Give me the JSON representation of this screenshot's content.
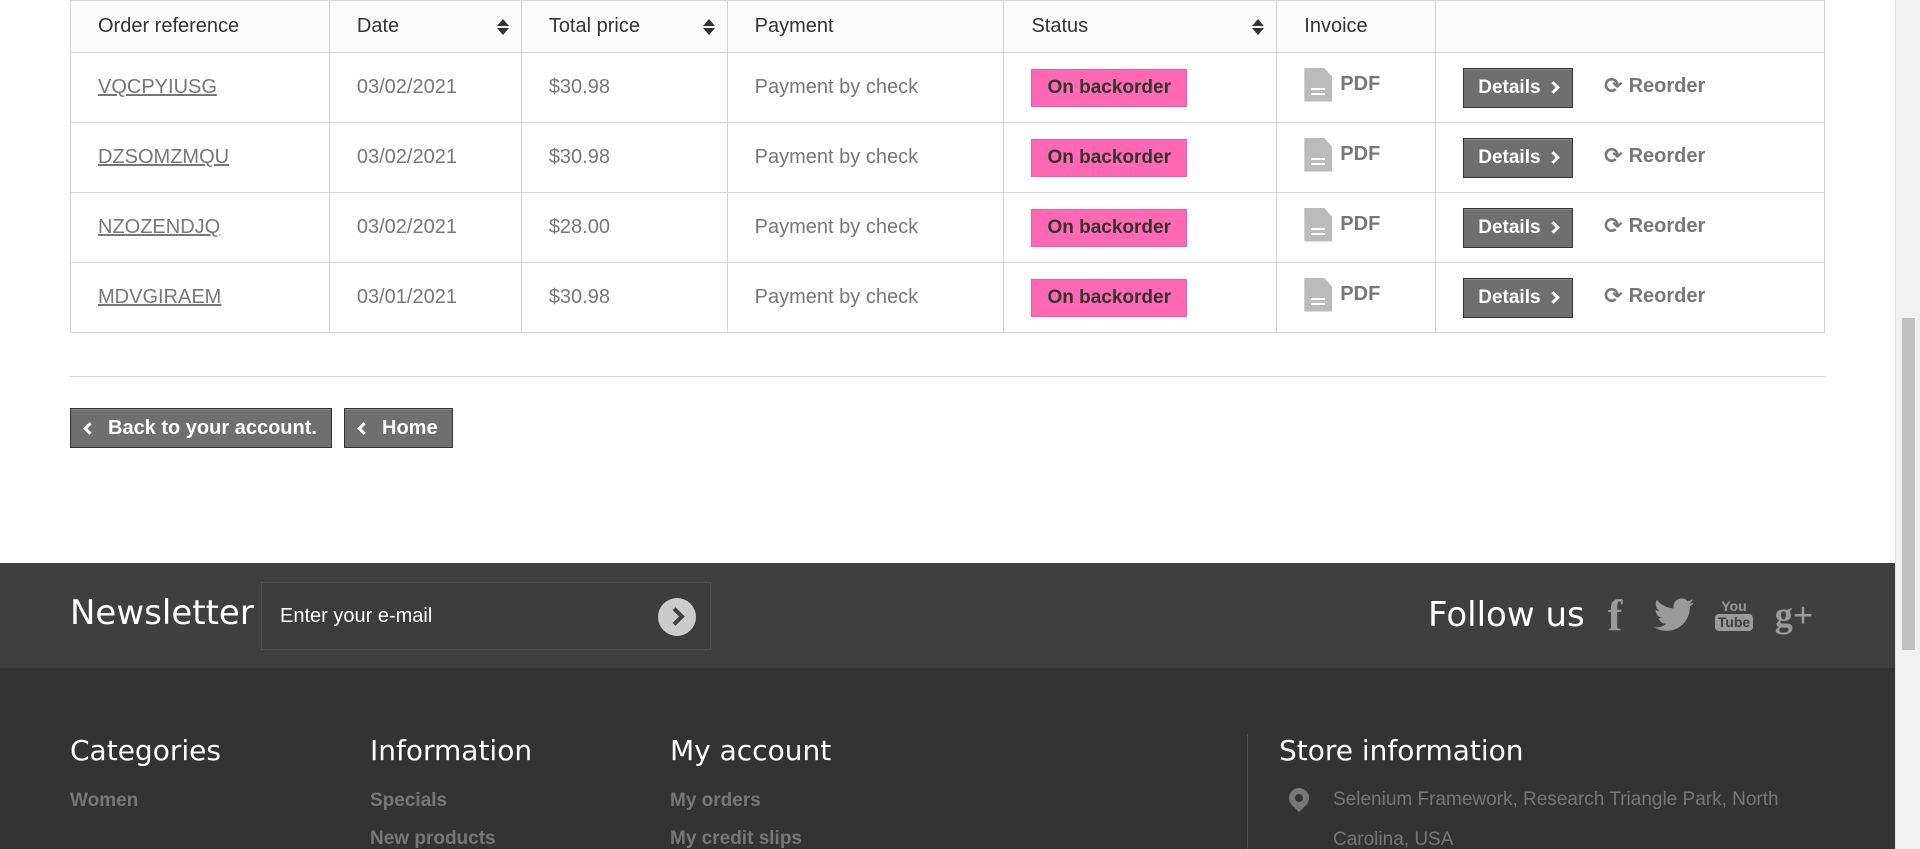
{
  "table": {
    "headers": [
      {
        "label": "Order reference",
        "sortable": false
      },
      {
        "label": "Date",
        "sortable": true
      },
      {
        "label": "Total price",
        "sortable": true
      },
      {
        "label": "Payment",
        "sortable": false
      },
      {
        "label": "Status",
        "sortable": true
      },
      {
        "label": "Invoice",
        "sortable": false
      },
      {
        "label": "",
        "sortable": false
      }
    ],
    "rows": [
      {
        "reference": "VQCPYIUSG",
        "date": "03/02/2021",
        "total": "$30.98",
        "payment": "Payment by check",
        "status": "On backorder",
        "invoice": "PDF",
        "details": "Details",
        "reorder": "Reorder"
      },
      {
        "reference": "DZSOMZMQU",
        "date": "03/02/2021",
        "total": "$30.98",
        "payment": "Payment by check",
        "status": "On backorder",
        "invoice": "PDF",
        "details": "Details",
        "reorder": "Reorder"
      },
      {
        "reference": "NZOZENDJQ",
        "date": "03/02/2021",
        "total": "$28.00",
        "payment": "Payment by check",
        "status": "On backorder",
        "invoice": "PDF",
        "details": "Details",
        "reorder": "Reorder"
      },
      {
        "reference": "MDVGIRAEM",
        "date": "03/01/2021",
        "total": "$30.98",
        "payment": "Payment by check",
        "status": "On backorder",
        "invoice": "PDF",
        "details": "Details",
        "reorder": "Reorder"
      }
    ]
  },
  "nav": {
    "back_label": "Back to your account.",
    "home_label": "Home"
  },
  "newsletter": {
    "title": "Newsletter",
    "placeholder": "Enter your e-mail"
  },
  "social": {
    "title": "Follow us",
    "icons": [
      "facebook-icon",
      "twitter-icon",
      "youtube-icon",
      "google-plus-icon"
    ],
    "youtube_top": "You",
    "youtube_bottom": "Tube",
    "facebook_glyph": "f",
    "googleplus_glyph": "g+"
  },
  "footer": {
    "categories": {
      "title": "Categories",
      "links": [
        "Women"
      ]
    },
    "information": {
      "title": "Information",
      "links": [
        "Specials",
        "New products"
      ]
    },
    "my_account": {
      "title": "My account",
      "links": [
        "My orders",
        "My credit slips"
      ]
    },
    "store": {
      "title": "Store information",
      "address": "Selenium Framework, Research Triangle Park, North Carolina, USA"
    }
  },
  "colors": {
    "status_badge": "#ff69b4",
    "button_bg": "#6f6f6f",
    "newsletter_bg": "#3f3f3f",
    "footer_bg": "#333333"
  }
}
